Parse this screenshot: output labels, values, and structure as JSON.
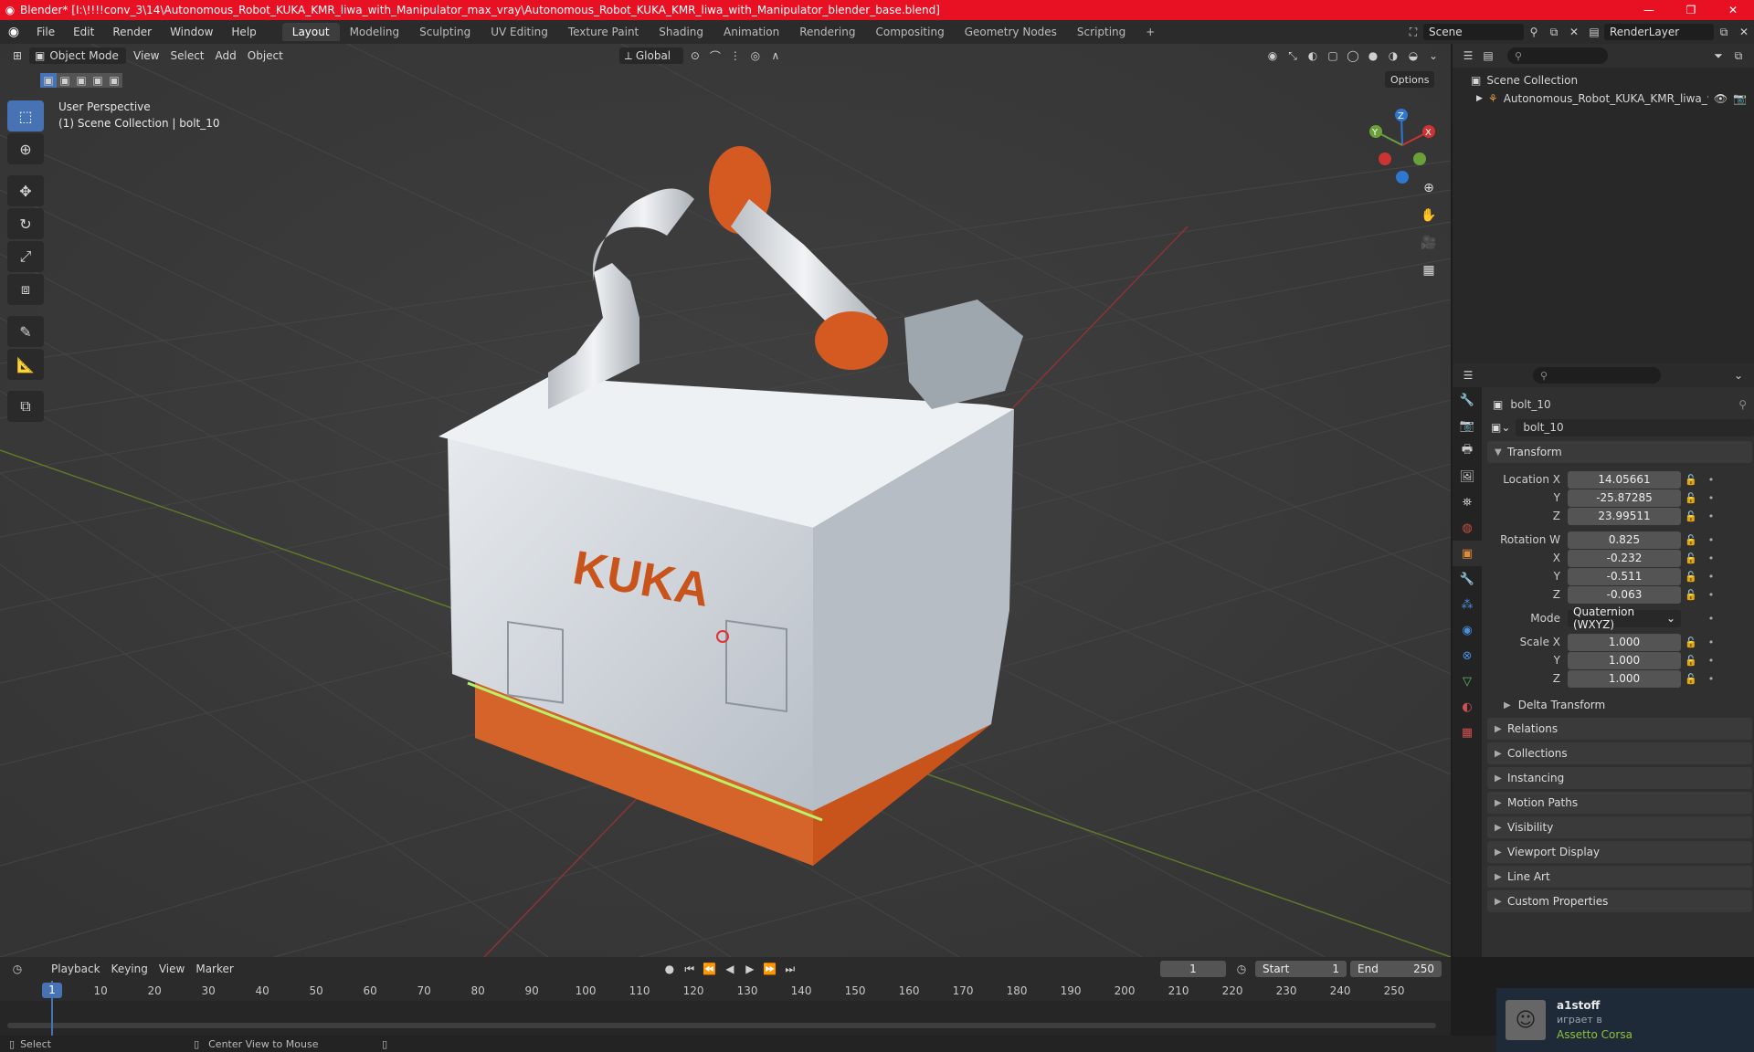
{
  "window": {
    "title": "Blender* [I:\\!!!!conv_3\\14\\Autonomous_Robot_KUKA_KMR_liwa_with_Manipulator_max_vray\\Autonomous_Robot_KUKA_KMR_liwa_with_Manipulator_blender_base.blend]"
  },
  "menu": {
    "items": [
      "File",
      "Edit",
      "Render",
      "Window",
      "Help"
    ],
    "workspaces": [
      "Layout",
      "Modeling",
      "Sculpting",
      "UV Editing",
      "Texture Paint",
      "Shading",
      "Animation",
      "Rendering",
      "Compositing",
      "Geometry Nodes",
      "Scripting"
    ],
    "add_tab": "+",
    "scene": "Scene",
    "render_layer": "RenderLayer"
  },
  "viewport": {
    "mode": "Object Mode",
    "menus": [
      "View",
      "Select",
      "Add",
      "Object"
    ],
    "orientation": "Global",
    "options": "Options",
    "info_line1": "User Perspective",
    "info_line2": "(1) Scene Collection | bolt_10",
    "model_label": "KUKA",
    "gizmo": {
      "z": "Z",
      "y": "Y",
      "x": "X"
    }
  },
  "outliner": {
    "root": "Scene Collection",
    "items": [
      {
        "label": "Autonomous_Robot_KUKA_KMR_liwa_w"
      }
    ]
  },
  "properties": {
    "object_name": "bolt_10",
    "data_name": "bolt_10",
    "transform_title": "Transform",
    "location_label": "Location X",
    "location": [
      "14.05661",
      "-25.87285",
      "23.99511"
    ],
    "rotation_label": "Rotation W",
    "rotation": [
      "0.825",
      "-0.232",
      "-0.511",
      "-0.063"
    ],
    "mode_label": "Mode",
    "mode_value": "Quaternion (WXYZ)",
    "scale_label": "Scale X",
    "scale": [
      "1.000",
      "1.000",
      "1.000"
    ],
    "axis_y": "Y",
    "axis_z": "Z",
    "axis_x": "X",
    "delta_transform": "Delta Transform",
    "panels": [
      "Relations",
      "Collections",
      "Instancing",
      "Motion Paths",
      "Visibility",
      "Viewport Display",
      "Line Art",
      "Custom Properties"
    ]
  },
  "timeline": {
    "menus": [
      "Playback",
      "Keying",
      "View",
      "Marker"
    ],
    "current_frame": "1",
    "start_label": "Start",
    "start_value": "1",
    "end_label": "End",
    "end_value": "250",
    "ticks": [
      "10",
      "20",
      "30",
      "40",
      "50",
      "60",
      "70",
      "80",
      "90",
      "100",
      "110",
      "120",
      "130",
      "140",
      "150",
      "160",
      "170",
      "180",
      "190",
      "200",
      "210",
      "220",
      "230",
      "240",
      "250"
    ],
    "playhead": "1"
  },
  "status": {
    "select": "Select",
    "center_view": "Center View to Mouse"
  },
  "notification": {
    "user": "a1stoff",
    "action": "играет в",
    "game": "Assetto Corsa"
  }
}
